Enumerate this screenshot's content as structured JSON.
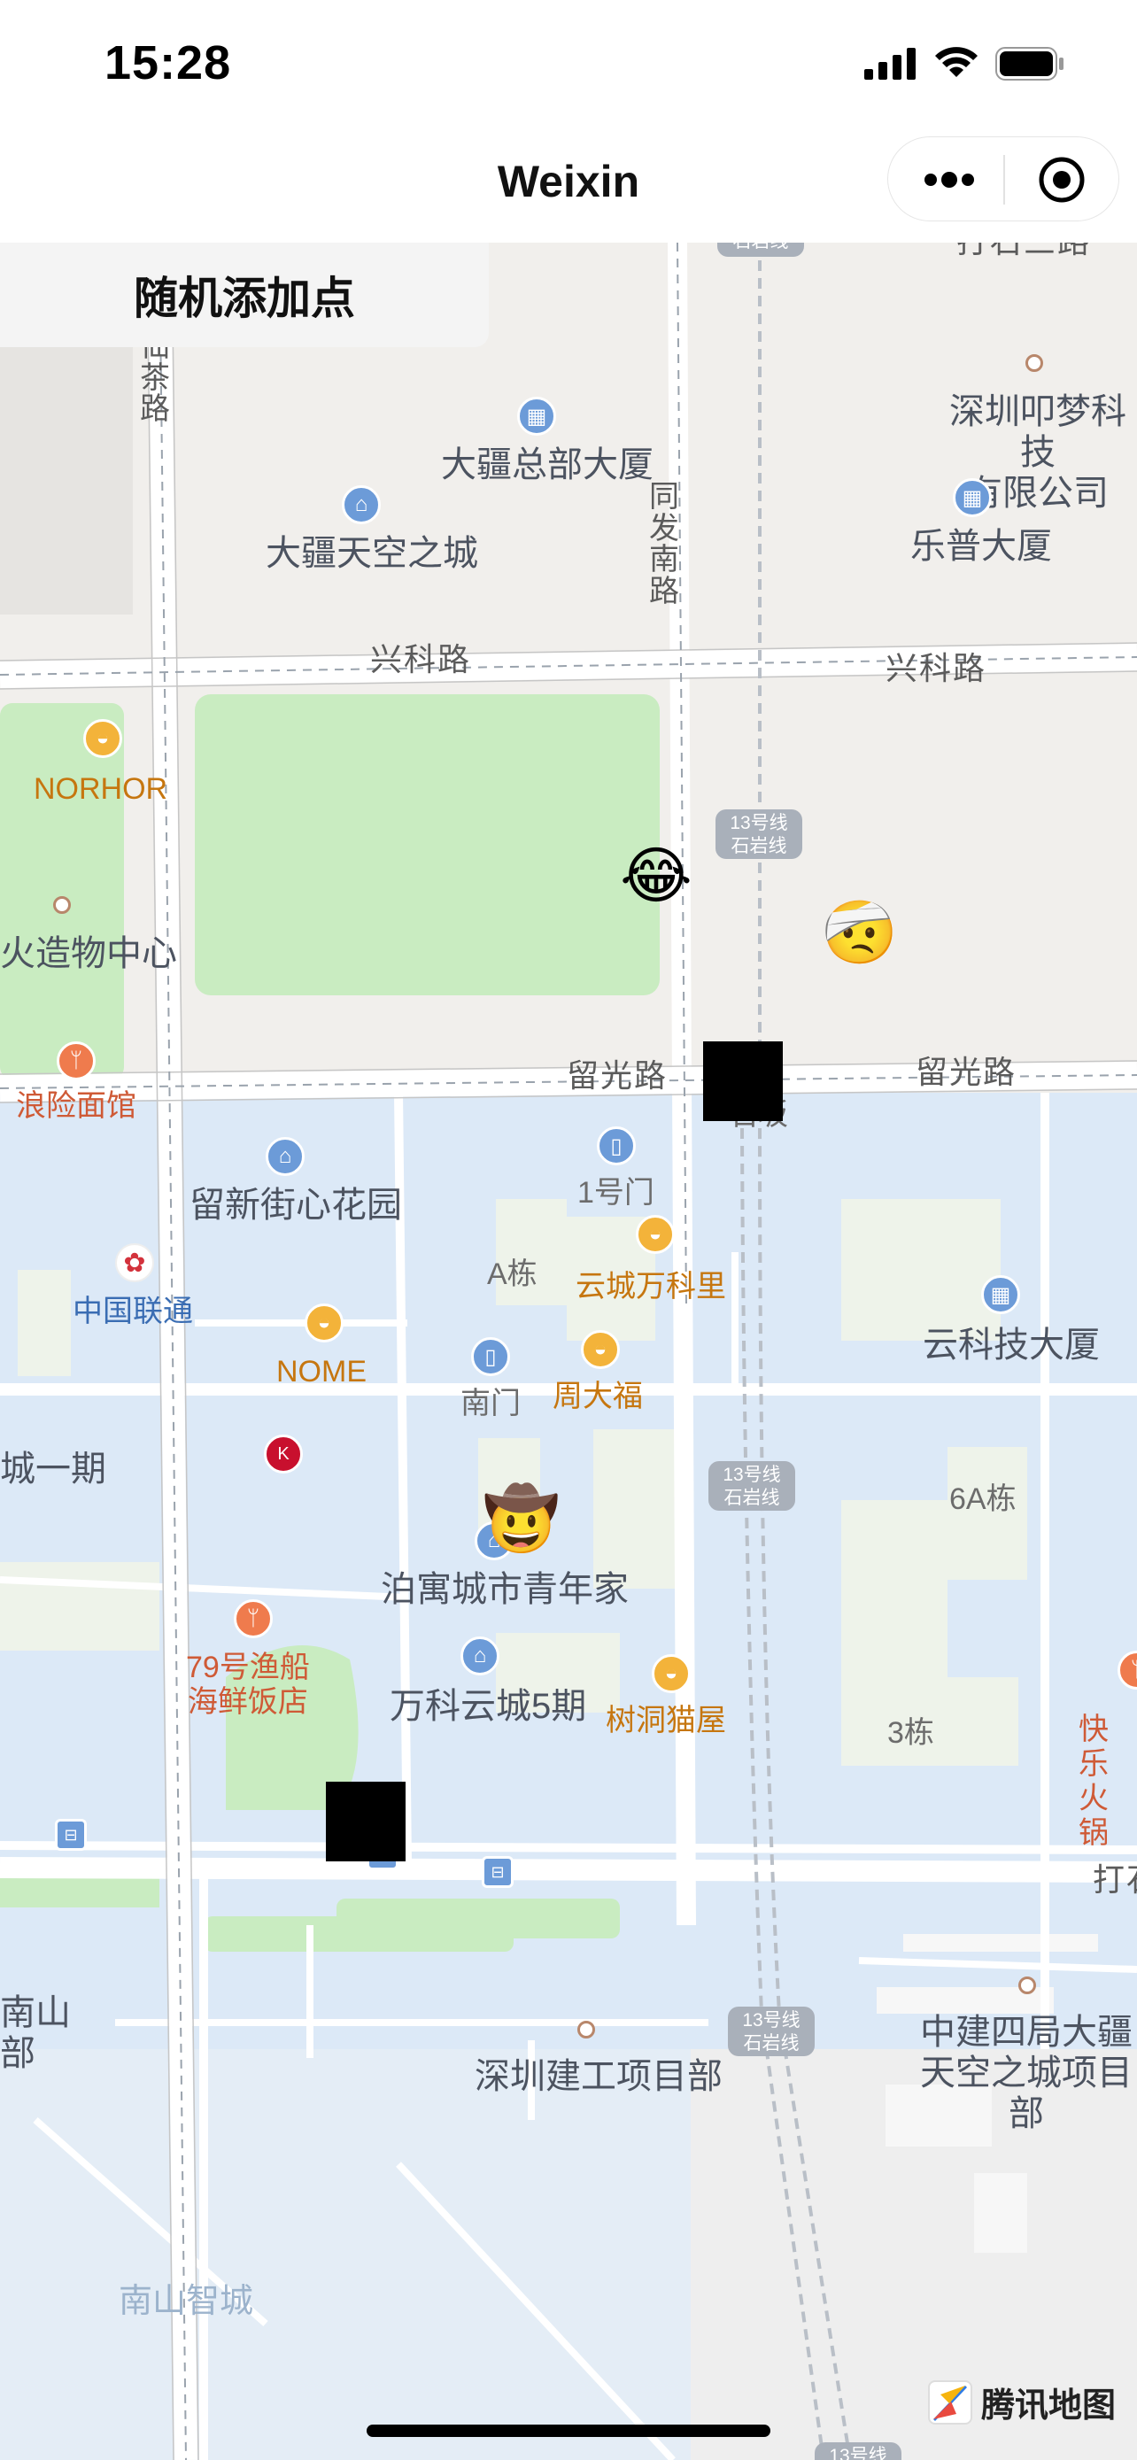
{
  "status_bar": {
    "time": "15:28"
  },
  "navbar": {
    "title": "Weixin"
  },
  "random_button": {
    "label": "随机添加点"
  },
  "map": {
    "roads": {
      "xianchalu": "仙茶路",
      "tongfanan": "同发南路",
      "xingke_left": "兴科路",
      "xingke_right": "兴科路",
      "liuguang_left": "留光路",
      "liuguang_right": "留光路",
      "dashi_top": "打石三路",
      "dashi_bottom": "打石"
    },
    "badges": {
      "top": "石岩线",
      "b1": "13号线\n石岩线",
      "b2": "13号线\n石岩线",
      "b3": "13号线\n石岩线",
      "bottom": "13号线"
    },
    "pois": {
      "dajiang_hq": "大疆总部大厦",
      "dajiang_tiankong": "大疆天空之城",
      "shenzhen_ye": "深圳叩梦科技\n有限公司",
      "lepu": "乐普大厦",
      "norhor": "NORHOR",
      "huozao": "火造物中心",
      "langxian": "浪险面馆",
      "liuxin": "留新街心花园",
      "gate1": "1号门",
      "unicom": "中国联通",
      "a_dong": "A栋",
      "yuncheng_wanli": "云城万科里",
      "yunkeji": "云科技大厦",
      "nome": "NOME",
      "south_gate": "南门",
      "zhoudafu": "周大福",
      "cheng_yiqi": "城一期",
      "dong_6a": "6A栋",
      "bowu": "泊寓城市青年家",
      "yuchuan": "79号渔船\n海鲜饭店",
      "vanke5": "万科云城5期",
      "shudong": "树洞猫屋",
      "dong_3": "3栋",
      "kuaile": "快乐\n火锅",
      "nanshan_bu": "南山\n部",
      "jiangong": "深圳建工项目部",
      "zhongjian": "中建四局大疆\n天空之城项目部",
      "nanshan_zhicheng": "南山智城",
      "station_partial": "石坂"
    },
    "markers": {
      "m1": "😂",
      "m2": "🤕",
      "m3": "🤠"
    },
    "logo": "腾讯地图"
  },
  "colors": {
    "park": "#c9ecc1",
    "water_block": "#dce9f7",
    "land": "#f1efec",
    "road": "#ffffff",
    "badge": "#a9b0ba",
    "poi_blue": "#6c9bd8",
    "poi_orange": "#f3b33a"
  }
}
